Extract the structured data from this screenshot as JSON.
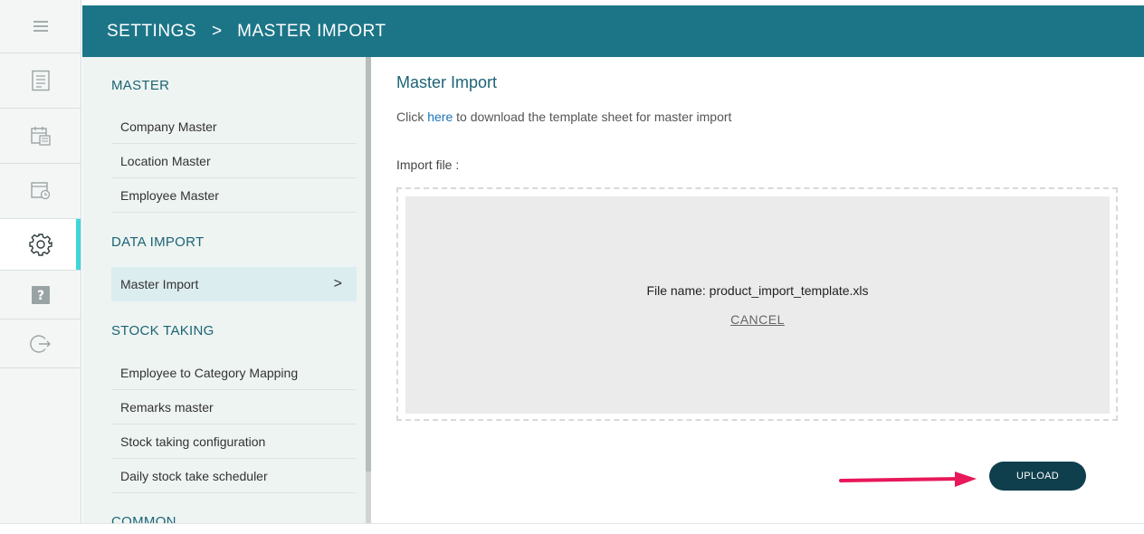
{
  "rail": {
    "items": [
      {
        "icon": "menu-icon"
      },
      {
        "icon": "document-icon"
      },
      {
        "icon": "calendar-icon"
      },
      {
        "icon": "schedule-icon"
      },
      {
        "icon": "gear-icon",
        "active": true
      },
      {
        "icon": "help-icon"
      },
      {
        "icon": "logout-icon"
      }
    ]
  },
  "header": {
    "crumb_root": "SETTINGS",
    "separator": ">",
    "crumb_current": "MASTER IMPORT"
  },
  "menu": {
    "sections": [
      {
        "title": "MASTER",
        "items": [
          "Company Master",
          "Location Master",
          "Employee Master"
        ]
      },
      {
        "title": "DATA IMPORT",
        "items": [
          "Master Import"
        ]
      },
      {
        "title": "STOCK TAKING",
        "items": [
          "Employee to Category Mapping",
          "Remarks master",
          "Stock taking configuration",
          "Daily stock take scheduler"
        ]
      },
      {
        "title": "COMMON",
        "items": []
      }
    ],
    "active_item": "Master Import",
    "active_chevron": ">"
  },
  "main": {
    "title": "Master Import",
    "hint_prefix": "Click ",
    "hint_link": "here",
    "hint_suffix": " to download the template sheet for master import",
    "import_label": "Import file :",
    "file_name": "File name: product_import_template.xls",
    "cancel_label": "CANCEL",
    "upload_label": "UPLOAD"
  },
  "colors": {
    "header": "#1c7587",
    "accent": "#3fd6d9",
    "upload_button": "#0f3e4c",
    "arrow": "#e8185a",
    "link": "#1a73b8"
  }
}
